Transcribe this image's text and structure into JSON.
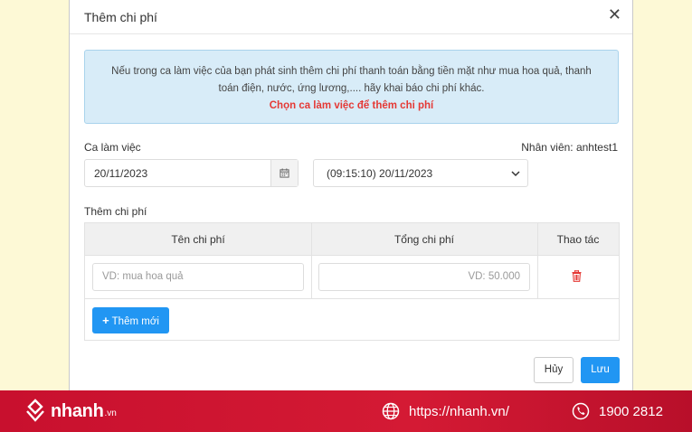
{
  "modal": {
    "title": "Thêm chi phí",
    "close_label": "✕",
    "info": {
      "line1": "Nếu trong ca làm việc của bạn phát sinh thêm chi phí thanh toán bằng tiền mặt như mua hoa quả, thanh",
      "line2": "toán điện, nước, ứng lương,.... hãy khai báo chi phí khác.",
      "warning": "Chọn ca làm việc để thêm chi phí"
    },
    "shift": {
      "label": "Ca làm việc",
      "employee": "Nhân viên: anhtest1",
      "date_value": "20/11/2023",
      "select_value": "(09:15:10) 20/11/2023"
    },
    "costs": {
      "section_label": "Thêm chi phí",
      "columns": [
        "Tên chi phí",
        "Tổng chi phí",
        "Thao tác"
      ],
      "row": {
        "name_placeholder": "VD: mua hoa quả",
        "amount_placeholder": "VD: 50.000"
      },
      "add_label": "Thêm mới"
    },
    "actions": {
      "cancel_label": "Hủy",
      "save_label": "Lưu"
    }
  },
  "footer": {
    "brand_name": "nhanh",
    "brand_tld": ".vn",
    "website": "https://nhanh.vn/",
    "phone": "1900 2812"
  },
  "colors": {
    "page_bg": "#fdf9d6",
    "accent_blue": "#2196f3",
    "info_bg": "#d8ecf8",
    "warning_red": "#e53935",
    "footer_red": "#c8102e"
  }
}
